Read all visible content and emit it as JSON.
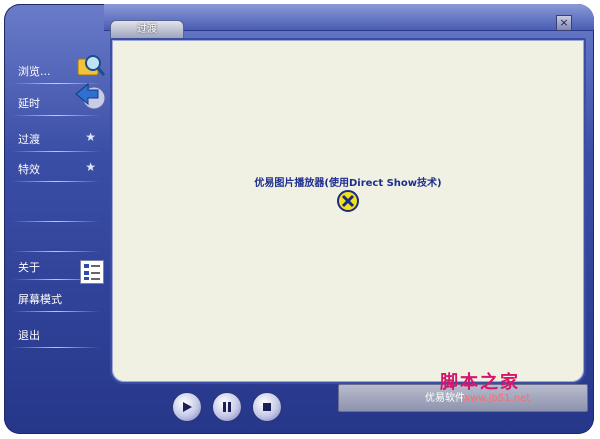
{
  "window": {
    "tab_label": "过渡",
    "close_label": "×"
  },
  "sidebar": {
    "items": [
      {
        "label": "浏览..."
      },
      {
        "label": "延时"
      },
      {
        "label": "过渡"
      },
      {
        "label": "特效"
      },
      {
        "label": "关于"
      },
      {
        "label": "屏幕模式"
      },
      {
        "label": "退出"
      }
    ]
  },
  "main": {
    "message": "优易图片播放器(使用Direct Show技术)"
  },
  "status": {
    "text": "优易软件"
  },
  "watermark": {
    "title": "脚本之家",
    "url": "www.jb51.net"
  },
  "colors": {
    "skin": "#3b4ea6",
    "content_bg": "#f0f0e3",
    "accent_text": "#1d2e8e",
    "watermark": "#d5166b"
  },
  "icons": [
    "browse-icon",
    "delay-icon",
    "star-icon",
    "about-icon",
    "error-icon",
    "play-icon",
    "pause-icon",
    "stop-icon",
    "close-icon"
  ]
}
